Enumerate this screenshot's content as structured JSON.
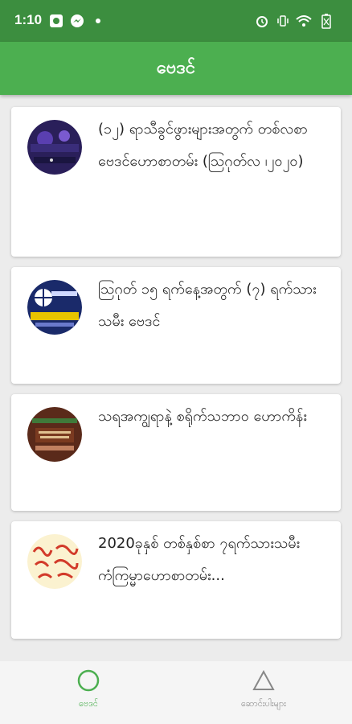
{
  "status_bar": {
    "time": "1:10",
    "icons": [
      "app-notification-icon",
      "messenger-icon",
      "dot-icon",
      "alarm-icon",
      "vibrate-icon",
      "wifi-icon",
      "battery-icon"
    ]
  },
  "app_bar": {
    "title": "ဗေဒင်"
  },
  "cards": [
    {
      "title": "(၁၂) ရာသီခွင်ဖွားများအတွက် တစ်လစာဗေဒင်ဟောစာတမ်း (ဩဂုတ်လ ၊၂၀၂၀)",
      "thumb_icon": "horoscope-thumbnail-icon"
    },
    {
      "title": "ဩဂုတ် ၁၅ ရက်နေ့အတွက် (၇) ရက်သားသမီး ဗေဒင်",
      "thumb_icon": "weekly-horoscope-thumbnail-icon"
    },
    {
      "title": "သရအကျွရာနဲ့ စရိုက်သဘာဝ ဟောကိန်း",
      "thumb_icon": "character-reading-thumbnail-icon"
    },
    {
      "title": "2020ခုနှစ် တစ်နှစ်စာ ၇ရက်သားသမီးကံကြမ္မာဟောစာတမ်း...",
      "thumb_icon": "zodiac-animals-thumbnail-icon"
    }
  ],
  "bottom_nav": {
    "items": [
      {
        "label": "ဗေဒင်",
        "icon": "circle-icon",
        "active": true
      },
      {
        "label": "ဆောင်းပါးများ",
        "icon": "triangle-icon",
        "active": false
      }
    ],
    "active_color": "#4caf50",
    "inactive_color": "#888888"
  }
}
